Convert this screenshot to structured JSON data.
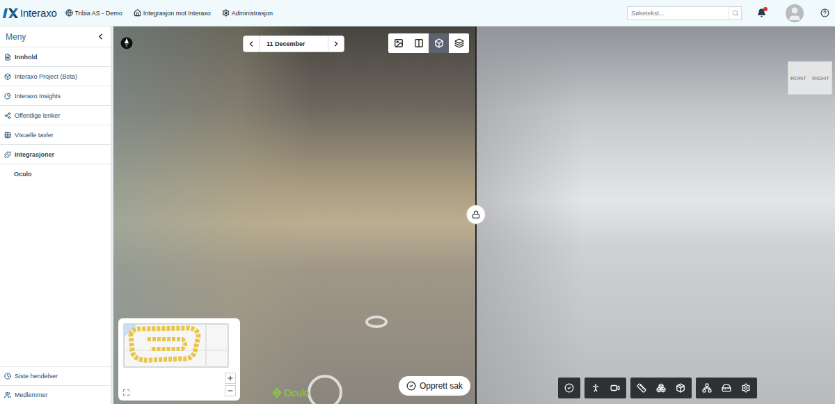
{
  "app": {
    "logo": "Interaxo"
  },
  "nav": [
    {
      "label": "Tribia AS - Demo"
    },
    {
      "label": "Integrasjon mot Interaxo"
    },
    {
      "label": "Administrasjon"
    }
  ],
  "search": {
    "placeholder": "Søketekst..."
  },
  "notifications": {
    "unread": true
  },
  "sidebar": {
    "title": "Meny",
    "items": [
      {
        "label": "Innhold",
        "kind": "section",
        "selected": false
      },
      {
        "label": "Interaxo Project (Beta)",
        "kind": "link",
        "selected": false
      },
      {
        "label": "Interaxo Insights",
        "kind": "link",
        "selected": false
      },
      {
        "label": "Offentlige lenker",
        "kind": "link",
        "selected": false
      },
      {
        "label": "Visuelle tavler",
        "kind": "link",
        "selected": false
      },
      {
        "label": "Integrasjoner",
        "kind": "section",
        "selected": false
      },
      {
        "label": "Oculo",
        "kind": "child",
        "selected": true
      }
    ],
    "footer": [
      {
        "label": "Siste hendelser"
      },
      {
        "label": "Medlemmer"
      }
    ]
  },
  "viewer": {
    "date": "11 December",
    "modes": [
      {
        "selected": false
      },
      {
        "selected": false
      },
      {
        "selected": true
      },
      {
        "selected": false
      }
    ],
    "locked": true,
    "watermark": "Oculo",
    "create_button": "Opprett sak"
  },
  "model": {
    "viewcube": [
      "RONT",
      "RIGHT"
    ]
  }
}
